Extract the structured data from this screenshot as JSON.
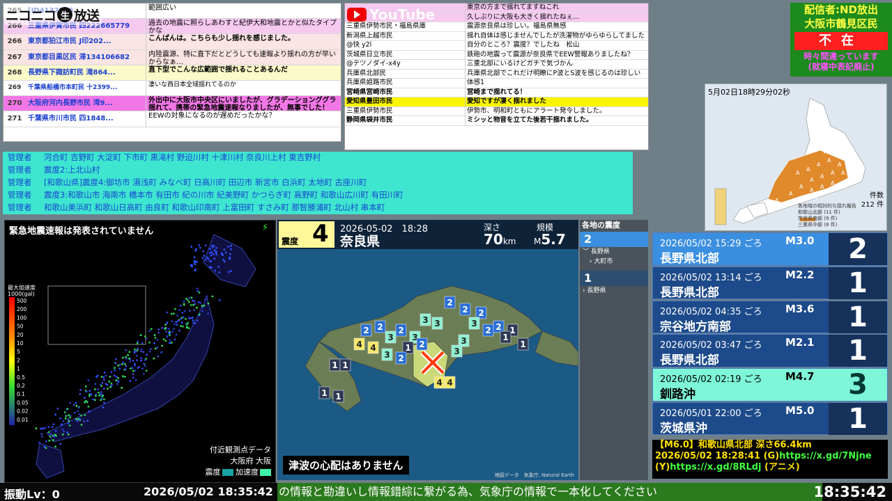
{
  "brand": {
    "nico_logo": "ニコニコ",
    "nico_live": "生",
    "nico_suffix": "放送",
    "youtube_logo": "YouTube"
  },
  "comments_left": [
    {
      "no": "265",
      "user": "[ID4132226...",
      "msg": "範囲広い",
      "style": "white"
    },
    {
      "no": "266",
      "user": "三重県伊賀市民 四222665779",
      "msg": "過去の地震に照らしあわすと紀伊大和地震とかと似たタイプかな",
      "style": "pink"
    },
    {
      "no": "266",
      "user": "東京都狛江市民 J印202...",
      "msg": "こんばんは。こちらも少し揺れを感じました。",
      "style": "peach",
      "bold": true
    },
    {
      "no": "267",
      "user": "東京都目黒区民 滞134106682",
      "msg": "内陸震源、特に直下だとどうしても速報より揺れの方が早いからなぁ…",
      "style": "peach"
    },
    {
      "no": "268",
      "user": "長野県下諏訪町民 滝864...",
      "msg": "直下型でこんな広範囲で揺れることあるんだ",
      "style": "yellow",
      "bold": true
    },
    {
      "no": "269",
      "user": "千葉県船橋市本町民 十2399...",
      "msg": "凄いな西日本全域揺れてるのか",
      "style": "white",
      "small": true
    },
    {
      "no": "270",
      "user": "大阪府河内長野市民 湾9...",
      "msg": "外出中に大阪市中央区にいましたが、グラデーションググラ揺れて、携帯の緊急地震速報なりましたが、無事でした！",
      "style": "magenta",
      "bold": true
    },
    {
      "no": "271",
      "user": "千葉県市川市民 四1848...",
      "msg": "EEWの対象になるのが遅めだったかな？",
      "style": "white"
    }
  ],
  "comments_mid": [
    {
      "user": "",
      "msg": "東京の方まで揺れてますねこれ",
      "style": "pink"
    },
    {
      "user": "",
      "msg": "久しぶりに大阪も大きく揺れたねぇ…",
      "style": "pink"
    },
    {
      "user": "三重県伊勢市民・福島県庫",
      "msg": "震源奈良県は珍しい。福島県無感",
      "style": "white"
    },
    {
      "user": "新潟県上越市民",
      "msg": "揺れ自体は感じませんでしたが洗濯物がゆらゆらしてました",
      "style": "white"
    },
    {
      "user": "@快 y2l",
      "msg": "自分のところ？震度？でしたね　松山",
      "style": "white"
    },
    {
      "user": "茨城県日立市民",
      "msg": "鉄砲の地震って震源が奈良県でEEW警報ありましたね？",
      "style": "white"
    },
    {
      "user": "@テツノダイ-x4y",
      "msg": "三重北部にいるけどガチで気づかん",
      "style": "white"
    },
    {
      "user": "兵庫県北部民",
      "msg": "兵庫県北部でこれだけ明瞭にP波とS波を感じるのは珍しい",
      "style": "white"
    },
    {
      "user": "兵庫県姫路市民",
      "msg": "体感1",
      "style": "white"
    },
    {
      "user": "宮崎県宮崎市民",
      "msg": "宮崎まで揺れてる！",
      "style": "boldrow"
    },
    {
      "user": "愛知県豊田市民",
      "msg": "愛知ですが凄く揺れました",
      "style": "yellow"
    },
    {
      "user": "三重県伊勢市民",
      "msg": "伊勢市、明和町ともにアラート発令しました。",
      "style": "white"
    },
    {
      "user": "静岡県袋井市民",
      "msg": "ミシッと物音を立てた後若干揺れました。",
      "style": "boldrow"
    }
  ],
  "caster": {
    "line1": "配信者:ND放出",
    "line2": "大阪市鶴見区民",
    "status": "不在",
    "note1": "時々間違っています",
    "note2": "(就寝中表記廃止)"
  },
  "admin": {
    "label": "管理者",
    "rows": [
      "河合町 吉野町 大淀町 下市町 黒滝村 野迫川村 十津川村 奈良川上村 東吉野村",
      "震度2:上北山村",
      "[和歌山県]震度4:御坊市 湯浅町 みなべ町 日高川町 田辺市 新宮市 白浜町 太地町 古座川町",
      "震度3:和歌山市 海南市 橋本市 有田市 紀の川市 紀美野町 かつらぎ町 高野町 和歌山広川町 有田川町",
      "和歌山美浜町 和歌山日高町 由良町 和歌山印南町 上富田町 すさみ町 那智勝浦町 北山村 串本町"
    ]
  },
  "tmap": {
    "time": "5月02日18時29分02秒",
    "count_label": "件数",
    "count": "212 件",
    "legend_title": "各地域の相対的な揺れ報告",
    "legend_items": [
      "和歌山北部 (11 件)",
      "奈良県南部 (9 件)",
      "三重県中部 (8 件)"
    ],
    "regions": [
      "A",
      "A",
      "A",
      "A",
      "A",
      "A",
      "A",
      "A",
      "A",
      "A",
      "A",
      "A",
      "A",
      "A",
      "A",
      "A",
      "A",
      "A",
      "A",
      "A",
      "A",
      "A"
    ]
  },
  "eew": {
    "status": "緊急地震速報は発表されていません",
    "legend_title": "最大加速度",
    "legend_unit": "1000(gal)",
    "legend_ticks": [
      "500",
      "200",
      "100",
      "50",
      "20",
      "10",
      "5",
      "2",
      "1",
      "0.5",
      "0.2",
      "0.1",
      "0.05",
      "0.02",
      "0.01"
    ],
    "nearby_title": "付近観測点データ",
    "nearby_place": "大阪府 大阪",
    "nearby_int_label": "震度",
    "nearby_acc_label": "加速度",
    "colors": {
      "int": "#19a3a3",
      "acc": "#3ff0a8"
    }
  },
  "quake": {
    "shindo_label": "震度",
    "shindo": "4",
    "time": "2026-05-02　18:28",
    "place": "奈良県",
    "depth_label": "深さ",
    "depth": "70",
    "depth_unit": "km",
    "mag_label": "規模",
    "mag_prefix": "M",
    "mag": "5.7",
    "tsunami": "津波の心配はありません",
    "credit": "地図データ　気象庁, Natural Earth",
    "markers": [
      {
        "v": "2",
        "c": "blue"
      },
      {
        "v": "2",
        "c": "blue"
      },
      {
        "v": "3",
        "c": "teal"
      },
      {
        "v": "3",
        "c": "teal"
      },
      {
        "v": "2",
        "c": "blue"
      },
      {
        "v": "1",
        "c": "navy"
      },
      {
        "v": "1",
        "c": "navy"
      },
      {
        "v": "2",
        "c": "blue"
      },
      {
        "v": "3",
        "c": "teal"
      },
      {
        "v": "4",
        "c": "yellow"
      },
      {
        "v": "4",
        "c": "yellow"
      },
      {
        "v": "3",
        "c": "teal"
      },
      {
        "v": "2",
        "c": "blue"
      },
      {
        "v": "1",
        "c": "navy"
      },
      {
        "v": "1",
        "c": "navy"
      }
    ]
  },
  "region": {
    "title": "各地の震度",
    "bands": [
      {
        "level": "2",
        "prefs": [
          {
            "name": "長野県",
            "cities": [
              "大町市"
            ]
          }
        ]
      },
      {
        "level": "1",
        "prefs": [
          {
            "name": "長野県",
            "cities": []
          }
        ]
      }
    ]
  },
  "quake_list": [
    {
      "time": "2026/05/02 15:29 ごろ",
      "mag": "M3.0",
      "name": "長野県北部",
      "int": "2",
      "style": "hl"
    },
    {
      "time": "2026/05/02 13:14 ごろ",
      "mag": "M2.2",
      "name": "長野県北部",
      "int": "1",
      "style": ""
    },
    {
      "time": "2026/05/02 04:35 ごろ",
      "mag": "M3.6",
      "name": "宗谷地方南部",
      "int": "1",
      "style": ""
    },
    {
      "time": "2026/05/02 03:47 ごろ",
      "mag": "M2.1",
      "name": "長野県北部",
      "int": "1",
      "style": ""
    },
    {
      "time": "2026/05/02 02:19 ごろ",
      "mag": "M4.7",
      "name": "釧路沖",
      "int": "3",
      "style": "teal"
    },
    {
      "time": "2026/05/01 22:00 ごろ",
      "mag": "M5.0",
      "name": "茨城県沖",
      "int": "1",
      "style": ""
    }
  ],
  "flash": {
    "line1": "【M6.0】和歌山県北部 深さ66.4km",
    "line2_pre": "2026/05/02 18:28:41 (G)",
    "line2_link": "https://x.gd/7Njne",
    "line3_pre": "(Y)",
    "line3_link": "https://x.gd/8RLdj",
    "line3_post": " (アニメ)"
  },
  "bottom": {
    "vib": "振動Lv：0",
    "now": "2026/05/02 18:35:42",
    "ticker": "の情報と勘違いし情報錯綜に繋がる為、気象庁の情報で一本化してください",
    "clock": "18:35:42"
  }
}
